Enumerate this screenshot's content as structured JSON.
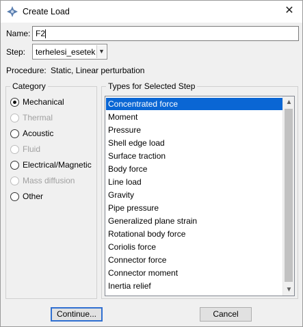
{
  "window": {
    "title": "Create Load",
    "icon": "abaqus-app-icon",
    "close_glyph": "✕"
  },
  "form": {
    "name_label": "Name:",
    "name_value": "F2",
    "step_label": "Step:",
    "step_value": "terhelesi_esetek",
    "procedure_label": "Procedure:",
    "procedure_value": "Static, Linear perturbation"
  },
  "category": {
    "title": "Category",
    "options": [
      {
        "label": "Mechanical",
        "checked": true,
        "disabled": false
      },
      {
        "label": "Thermal",
        "checked": false,
        "disabled": true
      },
      {
        "label": "Acoustic",
        "checked": false,
        "disabled": false
      },
      {
        "label": "Fluid",
        "checked": false,
        "disabled": true
      },
      {
        "label": "Electrical/Magnetic",
        "checked": false,
        "disabled": false
      },
      {
        "label": "Mass diffusion",
        "checked": false,
        "disabled": true
      },
      {
        "label": "Other",
        "checked": false,
        "disabled": false
      }
    ]
  },
  "types": {
    "title": "Types for Selected Step",
    "selected_index": 0,
    "items": [
      "Concentrated force",
      "Moment",
      "Pressure",
      "Shell edge load",
      "Surface traction",
      "Body force",
      "Line load",
      "Gravity",
      "Pipe pressure",
      "Generalized plane strain",
      "Rotational body force",
      "Coriolis force",
      "Connector force",
      "Connector moment",
      "Inertia relief"
    ]
  },
  "buttons": {
    "continue_label": "Continue...",
    "cancel_label": "Cancel"
  },
  "colors": {
    "selection": "#0a66d4",
    "disabled_text": "#a0a0a0"
  }
}
